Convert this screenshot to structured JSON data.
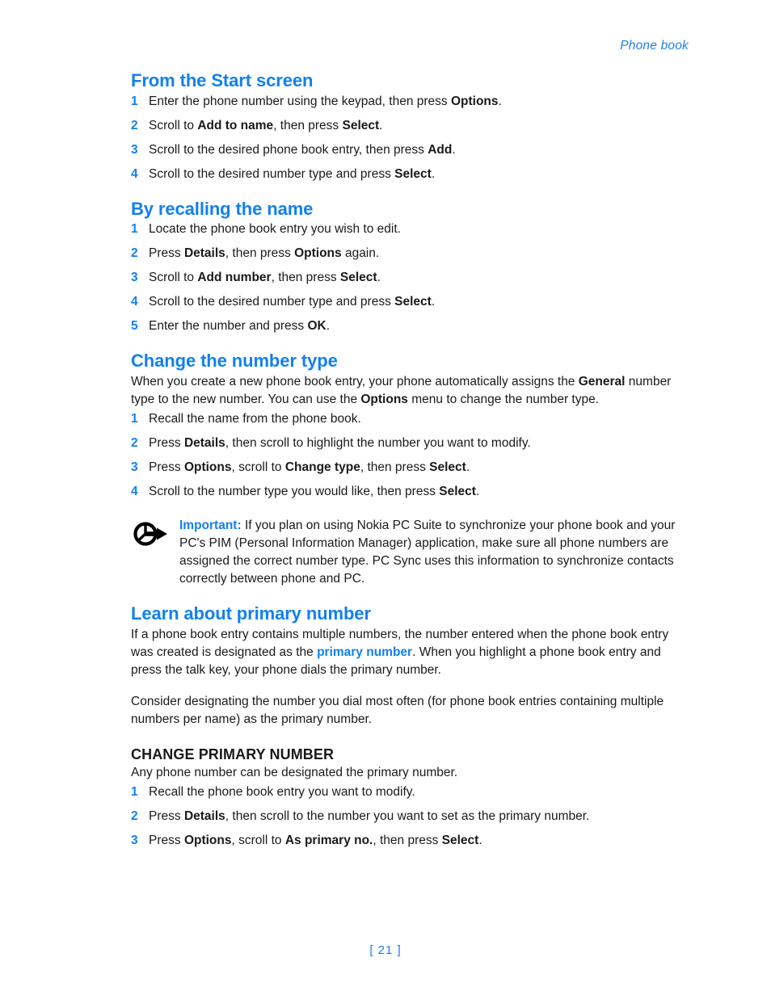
{
  "header": {
    "running_head": "Phone book"
  },
  "sections": [
    {
      "id": "from-the-start-screen",
      "heading": "From the Start screen",
      "steps": [
        {
          "n": "1",
          "parts": [
            {
              "t": "Enter the phone number using the keypad, then press ",
              "b": false
            },
            {
              "t": "Options",
              "b": true
            },
            {
              "t": ".",
              "b": false
            }
          ]
        },
        {
          "n": "2",
          "parts": [
            {
              "t": "Scroll to ",
              "b": false
            },
            {
              "t": "Add to name",
              "b": true
            },
            {
              "t": ", then press ",
              "b": false
            },
            {
              "t": "Select",
              "b": true
            },
            {
              "t": ".",
              "b": false
            }
          ]
        },
        {
          "n": "3",
          "parts": [
            {
              "t": "Scroll to the desired phone book entry, then press ",
              "b": false
            },
            {
              "t": "Add",
              "b": true
            },
            {
              "t": ".",
              "b": false
            }
          ]
        },
        {
          "n": "4",
          "parts": [
            {
              "t": "Scroll to the desired number type and press ",
              "b": false
            },
            {
              "t": "Select",
              "b": true
            },
            {
              "t": ".",
              "b": false
            }
          ]
        }
      ]
    },
    {
      "id": "by-recalling-the-name",
      "heading": "By recalling the name",
      "steps": [
        {
          "n": "1",
          "parts": [
            {
              "t": "Locate the phone book entry you wish to edit.",
              "b": false
            }
          ]
        },
        {
          "n": "2",
          "parts": [
            {
              "t": "Press ",
              "b": false
            },
            {
              "t": "Details",
              "b": true
            },
            {
              "t": ", then press ",
              "b": false
            },
            {
              "t": "Options",
              "b": true
            },
            {
              "t": " again.",
              "b": false
            }
          ]
        },
        {
          "n": "3",
          "parts": [
            {
              "t": "Scroll to ",
              "b": false
            },
            {
              "t": "Add number",
              "b": true
            },
            {
              "t": ", then press ",
              "b": false
            },
            {
              "t": "Select",
              "b": true
            },
            {
              "t": ".",
              "b": false
            }
          ]
        },
        {
          "n": "4",
          "parts": [
            {
              "t": "Scroll to the desired number type and press ",
              "b": false
            },
            {
              "t": "Select",
              "b": true
            },
            {
              "t": ".",
              "b": false
            }
          ]
        },
        {
          "n": "5",
          "parts": [
            {
              "t": "Enter the number and press ",
              "b": false
            },
            {
              "t": "OK",
              "b": true
            },
            {
              "t": ".",
              "b": false
            }
          ]
        }
      ]
    },
    {
      "id": "change-the-number-type",
      "heading": "Change the number type",
      "intro_parts": [
        {
          "t": "When you create a new phone book entry, your phone automatically assigns the ",
          "b": false
        },
        {
          "t": "General",
          "b": true
        },
        {
          "t": " number type to the new number. You can use the ",
          "b": false
        },
        {
          "t": "Options",
          "b": true
        },
        {
          "t": " menu to change the number type.",
          "b": false
        }
      ],
      "steps": [
        {
          "n": "1",
          "parts": [
            {
              "t": "Recall the name from the phone book.",
              "b": false
            }
          ]
        },
        {
          "n": "2",
          "parts": [
            {
              "t": "Press ",
              "b": false
            },
            {
              "t": "Details",
              "b": true
            },
            {
              "t": ", then scroll to highlight the number you want to modify.",
              "b": false
            }
          ]
        },
        {
          "n": "3",
          "parts": [
            {
              "t": "Press ",
              "b": false
            },
            {
              "t": "Options",
              "b": true
            },
            {
              "t": ", scroll to ",
              "b": false
            },
            {
              "t": "Change type",
              "b": true
            },
            {
              "t": ", then press ",
              "b": false
            },
            {
              "t": "Select",
              "b": true
            },
            {
              "t": ".",
              "b": false
            }
          ]
        },
        {
          "n": "4",
          "parts": [
            {
              "t": "Scroll to the number type you would like, then press ",
              "b": false
            },
            {
              "t": "Select",
              "b": true
            },
            {
              "t": ".",
              "b": false
            }
          ]
        }
      ]
    }
  ],
  "note": {
    "icon": "important-arrow-icon",
    "label": "Important:",
    "text": " If you plan on using Nokia PC Suite to synchronize your phone book and your PC's PIM (Personal Information Manager) application, make sure all phone numbers are assigned the correct number type. PC Sync uses this information to synchronize contacts correctly between phone and PC."
  },
  "primary_number_section": {
    "heading": "Learn about primary number",
    "para1_parts": [
      {
        "t": "If a phone book entry contains multiple numbers, the number entered when the phone book entry was created is designated as the ",
        "b": false,
        "blue": false
      },
      {
        "t": "primary number",
        "b": true,
        "blue": true
      },
      {
        "t": ". When you highlight a phone book entry and press the talk key, your phone dials the primary number.",
        "b": false,
        "blue": false
      }
    ],
    "para2": "Consider designating the number you dial most often (for phone book entries containing multiple numbers per name) as the primary number.",
    "sub_heading": "CHANGE PRIMARY NUMBER",
    "sub_intro": "Any phone number can be designated the primary number.",
    "steps": [
      {
        "n": "1",
        "parts": [
          {
            "t": "Recall the phone book entry you want to modify.",
            "b": false
          }
        ]
      },
      {
        "n": "2",
        "parts": [
          {
            "t": "Press ",
            "b": false
          },
          {
            "t": "Details",
            "b": true
          },
          {
            "t": ", then scroll to the number you want to set as the primary number.",
            "b": false
          }
        ]
      },
      {
        "n": "3",
        "parts": [
          {
            "t": "Press ",
            "b": false
          },
          {
            "t": "Options",
            "b": true
          },
          {
            "t": ", scroll to ",
            "b": false
          },
          {
            "t": "As primary no.",
            "b": true
          },
          {
            "t": ", then press ",
            "b": false
          },
          {
            "t": "Select",
            "b": true
          },
          {
            "t": ".",
            "b": false
          }
        ]
      }
    ]
  },
  "footer": {
    "page_number": "[ 21 ]"
  },
  "colors": {
    "accent_blue": "#1180f0",
    "body_text": "#1a1a1a",
    "background": "#ffffff"
  }
}
